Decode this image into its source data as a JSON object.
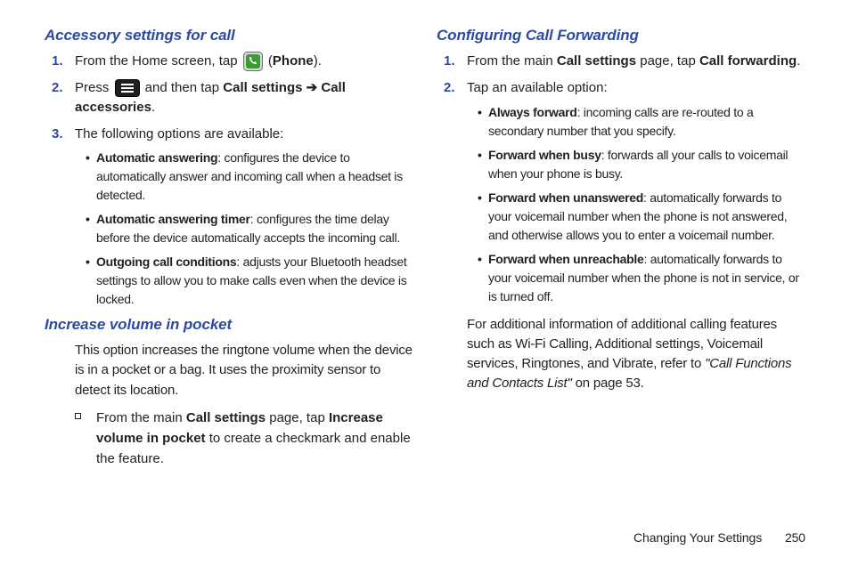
{
  "left": {
    "heading1": "Accessory settings for call",
    "step1_a": "From the Home screen, tap ",
    "step1_b": "Phone",
    "step2_a": "Press ",
    "step2_b": " and then tap ",
    "step2_c": "Call settings ➔ Call accessories",
    "step3": "The following options are available:",
    "opts": [
      {
        "title": "Automatic answering",
        "desc": ": configures the device to automatically answer and incoming call when a headset is detected."
      },
      {
        "title": "Automatic answering timer",
        "desc": ": configures the time delay before the device automatically accepts the incoming call."
      },
      {
        "title": "Outgoing call conditions",
        "desc": ": adjusts your Bluetooth headset settings to allow you to make calls even when the device is locked."
      }
    ],
    "heading2": "Increase volume in pocket",
    "para2": "This option increases the ringtone volume when the device is in a pocket or a bag. It uses the proximity sensor to detect its location.",
    "sq_a": "From the main ",
    "sq_b": "Call settings",
    "sq_c": " page, tap ",
    "sq_d": "Increase volume in pocket",
    "sq_e": " to create a checkmark and enable the feature."
  },
  "right": {
    "heading1": "Configuring Call Forwarding",
    "step1_a": "From the main ",
    "step1_b": "Call settings",
    "step1_c": " page, tap ",
    "step1_d": "Call forwarding",
    "step2": "Tap an available option:",
    "opts": [
      {
        "title": "Always forward",
        "desc": ": incoming calls are re-routed to a secondary number that you specify."
      },
      {
        "title": "Forward when busy",
        "desc": ": forwards all your calls to voicemail when your phone is busy."
      },
      {
        "title": "Forward when unanswered",
        "desc": ": automatically forwards to your voicemail number when the phone is not answered, and otherwise allows you to enter a voicemail number."
      },
      {
        "title": "Forward when unreachable",
        "desc": ": automatically forwards to your voicemail number when the phone is not in service, or is turned off."
      }
    ],
    "trail_a": "For additional information of additional calling features such as Wi-Fi Calling, Additional settings, Voicemail services, Ringtones, and Vibrate, refer to ",
    "trail_b": "\"Call Functions and Contacts List\"",
    "trail_c": " on page 53."
  },
  "footer": {
    "section": "Changing Your Settings",
    "page": "250"
  }
}
